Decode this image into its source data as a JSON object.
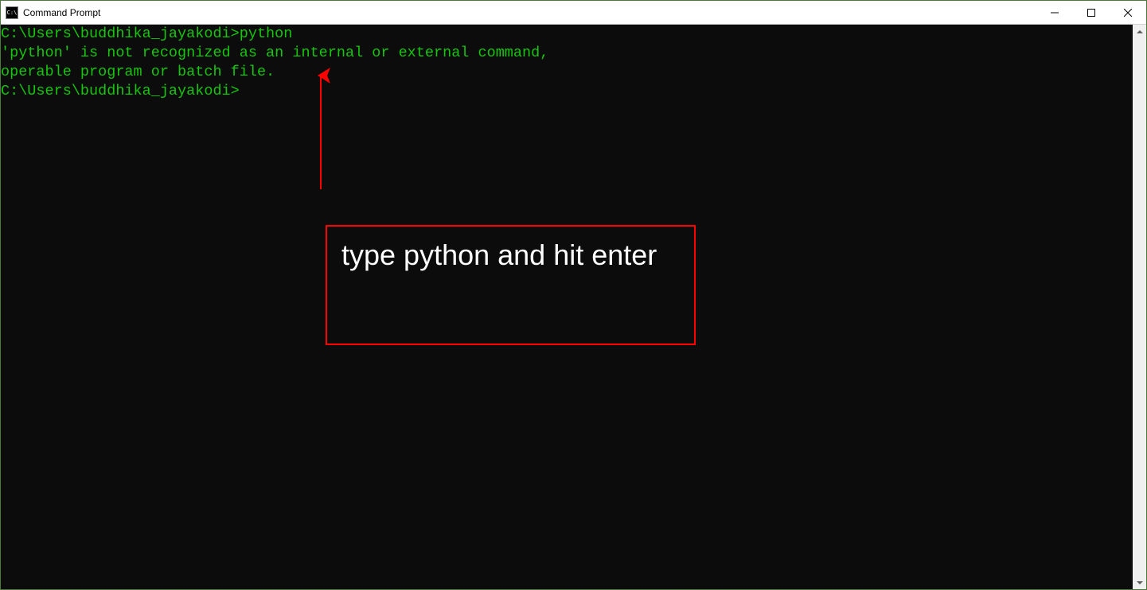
{
  "window": {
    "title": "Command Prompt",
    "icon_label": "C:\\"
  },
  "terminal": {
    "lines": [
      "",
      "C:\\Users\\buddhika_jayakodi>python",
      "'python' is not recognized as an internal or external command,",
      "operable program or batch file.",
      "",
      "C:\\Users\\buddhika_jayakodi>"
    ]
  },
  "annotation": {
    "text": "type python and hit enter",
    "arrow_color": "#ff0000",
    "box_color": "#ff0000"
  }
}
